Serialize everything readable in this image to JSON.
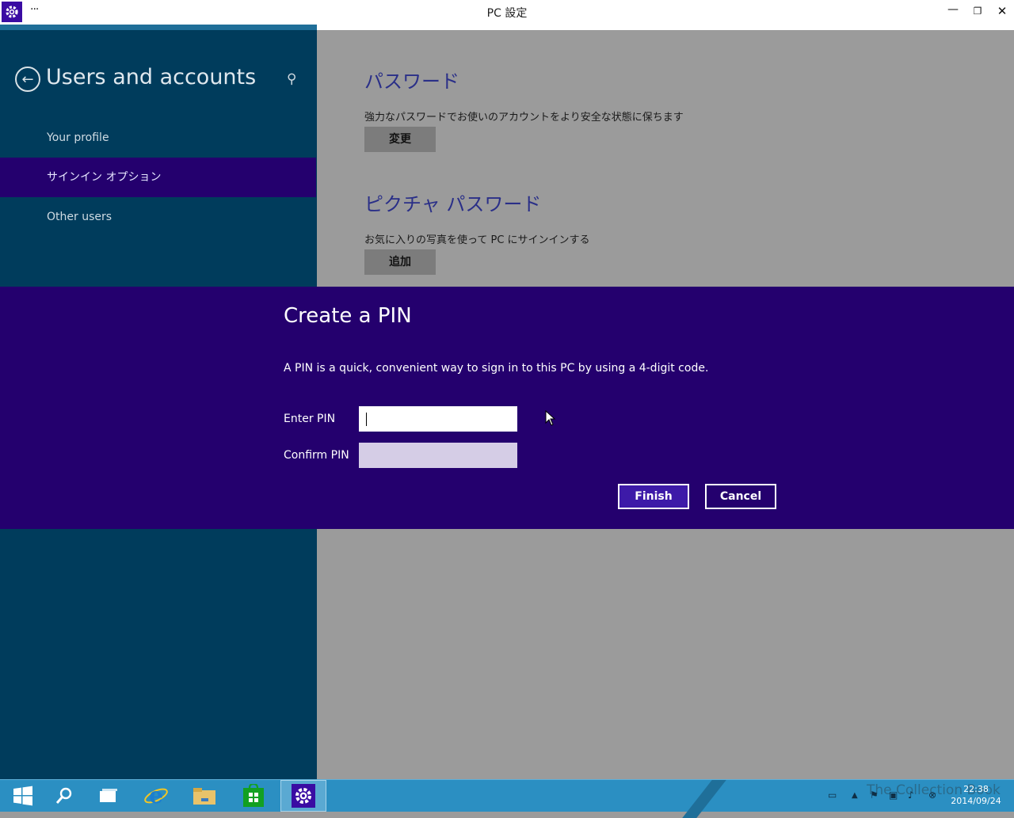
{
  "window": {
    "title": "PC 設定",
    "menu_glyph": "···",
    "min_glyph": "—",
    "max_glyph": "❐",
    "close_glyph": "✕"
  },
  "left_pane": {
    "title": "Users and accounts",
    "back_glyph": "←",
    "search_glyph": "⚲",
    "items": [
      {
        "label": "Your profile",
        "selected": false
      },
      {
        "label": "サインイン オプション",
        "selected": true
      },
      {
        "label": "Other users",
        "selected": false
      }
    ]
  },
  "content": {
    "password": {
      "title": "パスワード",
      "description": "強力なパスワードでお使いのアカウントをより安全な状態に保ちます",
      "button": "変更"
    },
    "picture_password": {
      "title": "ピクチャ パスワード",
      "description": "お気に入りの写真を使って PC にサインインする",
      "button": "追加"
    }
  },
  "pin_dialog": {
    "title": "Create a PIN",
    "description": "A PIN is a quick, convenient way to sign in to this PC by using a 4-digit code.",
    "enter_label": "Enter PIN",
    "enter_value": "",
    "confirm_label": "Confirm PIN",
    "confirm_value": "",
    "finish_button": "Finish",
    "cancel_button": "Cancel"
  },
  "taskbar": {
    "items": [
      "start-icon",
      "search-icon",
      "task-view-icon",
      "internet-explorer-icon",
      "file-explorer-icon",
      "store-icon",
      "settings-icon"
    ],
    "active_item": "settings-icon",
    "time": "22:38",
    "date": "2014/09/24",
    "watermark": "The Collection Book"
  },
  "colors": {
    "left_pane_bg": "#003c5c",
    "accent_purple": "#24006e",
    "content_bg": "#9b9b9b",
    "taskbar_bg": "#2b8fc2"
  }
}
